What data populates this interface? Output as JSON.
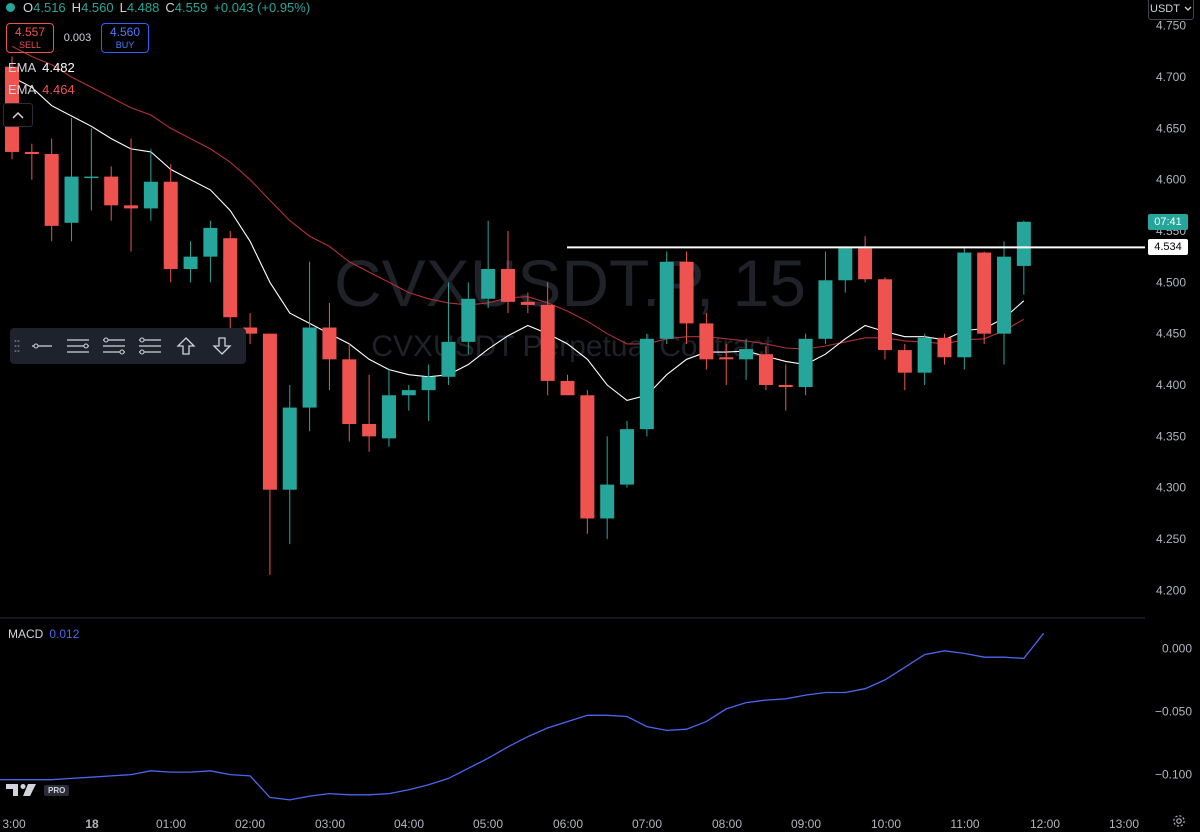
{
  "header": {
    "ohlc": {
      "o_label": "O",
      "o": "4.516",
      "h_label": "H",
      "h": "4.560",
      "l_label": "L",
      "l": "4.488",
      "c_label": "C",
      "c": "4.559",
      "change": "+0.043 (+0.95%)"
    },
    "sell": {
      "price": "4.557",
      "label": "SELL"
    },
    "spread": "0.003",
    "buy": {
      "price": "4.560",
      "label": "BUY"
    },
    "ema1": {
      "label": "EMA",
      "value": "4.482"
    },
    "ema2": {
      "label": "EMA",
      "value": "4.464"
    },
    "currency": "USDT"
  },
  "watermark": {
    "symbol": "CVXUSDT.P, 15",
    "description": "CVXUSDT Perpetual Contract"
  },
  "macd": {
    "label": "MACD",
    "value": "0.012"
  },
  "logo_badge": "PRO",
  "colors": {
    "up": "#26a69a",
    "down": "#ef5350",
    "ema_fast": "#ffffff",
    "ema_slow": "#b2303a",
    "macd": "#4a67f0",
    "line": "#ffffff"
  },
  "price_tags": {
    "countdown": "07:41",
    "line": "4.534"
  },
  "toolbar": {
    "icons": [
      "horizontal-line-icon",
      "horizontal-ray-icon",
      "parallel-lines-icon",
      "fib-levels-icon",
      "arrow-up-icon",
      "arrow-down-icon"
    ]
  },
  "chart_data": [
    {
      "type": "candlestick",
      "title": "CVXUSDT.P, 15",
      "ylim": [
        4.175,
        4.775
      ],
      "yticks": [
        4.2,
        4.25,
        4.3,
        4.35,
        4.4,
        4.45,
        4.5,
        4.55,
        4.6,
        4.65,
        4.7,
        4.75
      ],
      "xticks": [
        "3:00",
        "18",
        "01:00",
        "02:00",
        "03:00",
        "04:00",
        "05:00",
        "06:00",
        "07:00",
        "08:00",
        "09:00",
        "10:00",
        "11:00",
        "12:00",
        "13:00"
      ],
      "horizontal_line": 4.534,
      "candles": [
        {
          "o": 4.71,
          "h": 4.72,
          "l": 4.62,
          "c": 4.627
        },
        {
          "o": 4.627,
          "h": 4.635,
          "l": 4.6,
          "c": 4.625
        },
        {
          "o": 4.625,
          "h": 4.64,
          "l": 4.54,
          "c": 4.555
        },
        {
          "o": 4.558,
          "h": 4.66,
          "l": 4.54,
          "c": 4.603
        },
        {
          "o": 4.603,
          "h": 4.65,
          "l": 4.57,
          "c": 4.603
        },
        {
          "o": 4.603,
          "h": 4.613,
          "l": 4.56,
          "c": 4.575
        },
        {
          "o": 4.575,
          "h": 4.64,
          "l": 4.53,
          "c": 4.572
        },
        {
          "o": 4.572,
          "h": 4.63,
          "l": 4.56,
          "c": 4.598
        },
        {
          "o": 4.598,
          "h": 4.615,
          "l": 4.5,
          "c": 4.513
        },
        {
          "o": 4.513,
          "h": 4.54,
          "l": 4.5,
          "c": 4.525
        },
        {
          "o": 4.525,
          "h": 4.56,
          "l": 4.5,
          "c": 4.553
        },
        {
          "o": 4.543,
          "h": 4.55,
          "l": 4.45,
          "c": 4.466
        },
        {
          "o": 4.456,
          "h": 4.47,
          "l": 4.44,
          "c": 4.45
        },
        {
          "o": 4.45,
          "h": 4.45,
          "l": 4.215,
          "c": 4.298
        },
        {
          "o": 4.298,
          "h": 4.4,
          "l": 4.245,
          "c": 4.378
        },
        {
          "o": 4.378,
          "h": 4.52,
          "l": 4.355,
          "c": 4.456
        },
        {
          "o": 4.456,
          "h": 4.48,
          "l": 4.395,
          "c": 4.425
        },
        {
          "o": 4.425,
          "h": 4.44,
          "l": 4.345,
          "c": 4.362
        },
        {
          "o": 4.362,
          "h": 4.41,
          "l": 4.335,
          "c": 4.35
        },
        {
          "o": 4.348,
          "h": 4.415,
          "l": 4.34,
          "c": 4.39
        },
        {
          "o": 4.39,
          "h": 4.4,
          "l": 4.375,
          "c": 4.395
        },
        {
          "o": 4.395,
          "h": 4.42,
          "l": 4.365,
          "c": 4.408
        },
        {
          "o": 4.408,
          "h": 4.5,
          "l": 4.4,
          "c": 4.442
        },
        {
          "o": 4.442,
          "h": 4.5,
          "l": 4.43,
          "c": 4.484
        },
        {
          "o": 4.484,
          "h": 4.56,
          "l": 4.475,
          "c": 4.513
        },
        {
          "o": 4.513,
          "h": 4.55,
          "l": 4.47,
          "c": 4.481
        },
        {
          "o": 4.481,
          "h": 4.49,
          "l": 4.47,
          "c": 4.478
        },
        {
          "o": 4.478,
          "h": 4.5,
          "l": 4.39,
          "c": 4.404
        },
        {
          "o": 4.404,
          "h": 4.41,
          "l": 4.39,
          "c": 4.39
        },
        {
          "o": 4.39,
          "h": 4.395,
          "l": 4.255,
          "c": 4.27
        },
        {
          "o": 4.27,
          "h": 4.35,
          "l": 4.25,
          "c": 4.303
        },
        {
          "o": 4.303,
          "h": 4.365,
          "l": 4.3,
          "c": 4.357
        },
        {
          "o": 4.357,
          "h": 4.45,
          "l": 4.35,
          "c": 4.445
        },
        {
          "o": 4.445,
          "h": 4.53,
          "l": 4.44,
          "c": 4.52
        },
        {
          "o": 4.52,
          "h": 4.53,
          "l": 4.44,
          "c": 4.46
        },
        {
          "o": 4.46,
          "h": 4.47,
          "l": 4.415,
          "c": 4.425
        },
        {
          "o": 4.427,
          "h": 4.44,
          "l": 4.4,
          "c": 4.425
        },
        {
          "o": 4.425,
          "h": 4.445,
          "l": 4.405,
          "c": 4.435
        },
        {
          "o": 4.43,
          "h": 4.438,
          "l": 4.395,
          "c": 4.4
        },
        {
          "o": 4.4,
          "h": 4.42,
          "l": 4.375,
          "c": 4.398
        },
        {
          "o": 4.398,
          "h": 4.45,
          "l": 4.39,
          "c": 4.445
        },
        {
          "o": 4.445,
          "h": 4.53,
          "l": 4.44,
          "c": 4.502
        },
        {
          "o": 4.502,
          "h": 4.535,
          "l": 4.49,
          "c": 4.533
        },
        {
          "o": 4.533,
          "h": 4.545,
          "l": 4.5,
          "c": 4.503
        },
        {
          "o": 4.503,
          "h": 4.505,
          "l": 4.425,
          "c": 4.434
        },
        {
          "o": 4.434,
          "h": 4.44,
          "l": 4.395,
          "c": 4.412
        },
        {
          "o": 4.412,
          "h": 4.45,
          "l": 4.4,
          "c": 4.446
        },
        {
          "o": 4.446,
          "h": 4.45,
          "l": 4.42,
          "c": 4.427
        },
        {
          "o": 4.427,
          "h": 4.535,
          "l": 4.415,
          "c": 4.529
        },
        {
          "o": 4.529,
          "h": 4.53,
          "l": 4.44,
          "c": 4.45
        },
        {
          "o": 4.45,
          "h": 4.54,
          "l": 4.42,
          "c": 4.525
        },
        {
          "o": 4.516,
          "h": 4.56,
          "l": 4.488,
          "c": 4.559
        }
      ],
      "ema_fast": [
        4.7,
        4.69,
        4.672,
        4.662,
        4.652,
        4.64,
        4.63,
        4.627,
        4.61,
        4.6,
        4.59,
        4.57,
        4.54,
        4.5,
        4.47,
        4.46,
        4.45,
        4.44,
        4.425,
        4.415,
        4.41,
        4.408,
        4.41,
        4.42,
        4.435,
        4.448,
        4.458,
        4.45,
        4.44,
        4.425,
        4.4,
        4.385,
        4.39,
        4.41,
        4.425,
        4.432,
        4.432,
        4.433,
        4.428,
        4.423,
        4.42,
        4.43,
        4.445,
        4.458,
        4.452,
        4.447,
        4.447,
        4.444,
        4.453,
        4.455,
        4.465,
        4.482
      ],
      "ema_slow": [
        4.73,
        4.72,
        4.712,
        4.7,
        4.69,
        4.68,
        4.67,
        4.663,
        4.65,
        4.64,
        4.63,
        4.617,
        4.6,
        4.58,
        4.56,
        4.545,
        4.535,
        4.52,
        4.51,
        4.5,
        4.49,
        4.484,
        4.48,
        4.478,
        4.48,
        4.485,
        4.486,
        4.48,
        4.472,
        4.462,
        4.45,
        4.44,
        4.44,
        4.445,
        4.447,
        4.447,
        4.445,
        4.443,
        4.44,
        4.436,
        4.435,
        4.438,
        4.442,
        4.446,
        4.446,
        4.443,
        4.442,
        4.44,
        4.444,
        4.445,
        4.453,
        4.464
      ]
    },
    {
      "type": "line",
      "title": "MACD",
      "ylim": [
        -0.128,
        0.024
      ],
      "yticks": [
        0.0,
        -0.05,
        -0.1
      ],
      "ytick_labels": [
        "0.000",
        "−0.050",
        "−0.100"
      ],
      "series": [
        {
          "name": "MACD",
          "values": [
            -0.104,
            -0.104,
            -0.104,
            -0.103,
            -0.102,
            -0.101,
            -0.1,
            -0.097,
            -0.098,
            -0.098,
            -0.097,
            -0.1,
            -0.101,
            -0.118,
            -0.12,
            -0.117,
            -0.115,
            -0.116,
            -0.116,
            -0.115,
            -0.112,
            -0.108,
            -0.103,
            -0.095,
            -0.087,
            -0.078,
            -0.07,
            -0.063,
            -0.058,
            -0.053,
            -0.053,
            -0.054,
            -0.062,
            -0.065,
            -0.064,
            -0.058,
            -0.048,
            -0.043,
            -0.041,
            -0.04,
            -0.037,
            -0.035,
            -0.035,
            -0.032,
            -0.025,
            -0.015,
            -0.005,
            -0.002,
            -0.004,
            -0.007,
            -0.007,
            -0.008
          ]
        }
      ],
      "values_end": [
        0.0,
        0.0,
        0.0,
        0.003,
        0.005,
        0.012
      ]
    }
  ]
}
